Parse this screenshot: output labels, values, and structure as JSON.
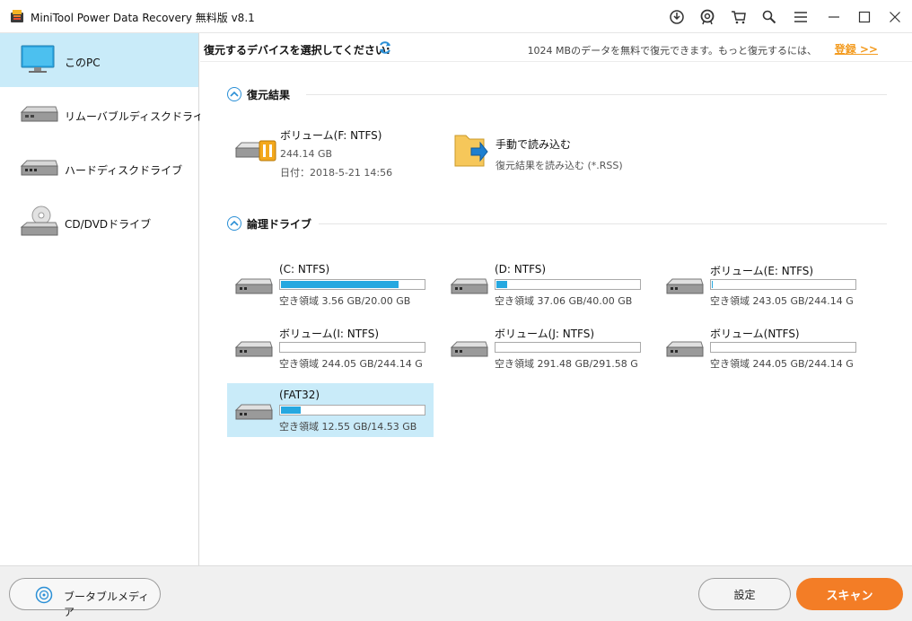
{
  "window": {
    "title": "MiniTool Power Data Recovery 無料版 v8.1",
    "controls": [
      "update-icon",
      "help-icon",
      "cart-icon",
      "search-icon",
      "menu-icon",
      "minimize-icon",
      "maximize-icon",
      "close-icon"
    ]
  },
  "sidebar": {
    "items": [
      {
        "label": "このPC",
        "icon": "pc-monitor-icon",
        "active": true
      },
      {
        "label": "リムーバブルディスクドライブ",
        "icon": "removable-drive-icon",
        "active": false
      },
      {
        "label": "ハードディスクドライブ",
        "icon": "hard-disk-icon",
        "active": false
      },
      {
        "label": "CD/DVDドライブ",
        "icon": "cd-dvd-drive-icon",
        "active": false
      }
    ]
  },
  "header": {
    "select_device_label": "復元するデバイスを選択してください:",
    "promo_text": "1024 MBのデータを無料で復元できます。もっと復元するには、",
    "register_link": "登録 >>"
  },
  "recovery_results": {
    "title": "復元結果",
    "items": [
      {
        "name": "ボリューム(F: NTFS)",
        "size": "244.14 GB",
        "date": "日付：2018-5-21 14:56"
      },
      {
        "name": "手動で読み込む",
        "desc": "復元結果を読み込む (*.RSS)"
      }
    ]
  },
  "logical_drives": {
    "title": "論理ドライブ",
    "drives": [
      {
        "name": "(C: NTFS)",
        "free": "空き領域 3.56 GB/20.00 GB",
        "used_fraction": 0.822
      },
      {
        "name": "(D: NTFS)",
        "free": "空き領域 37.06 GB/40.00 GB",
        "used_fraction": 0.074
      },
      {
        "name": "ボリューム(E: NTFS)",
        "free": "空き領域 243.05 GB/244.14 G",
        "used_fraction": 0.004
      },
      {
        "name": "ボリューム(I: NTFS)",
        "free": "空き領域 244.05 GB/244.14 G",
        "used_fraction": 0.0
      },
      {
        "name": "ボリューム(J: NTFS)",
        "free": "空き領域 291.48 GB/291.58 G",
        "used_fraction": 0.0
      },
      {
        "name": "ボリューム(NTFS)",
        "free": "空き領域 244.05 GB/244.14 G",
        "used_fraction": 0.0
      },
      {
        "name": "(FAT32)",
        "free": "空き領域 12.55 GB/14.53 GB",
        "used_fraction": 0.136,
        "selected": true
      }
    ]
  },
  "footer": {
    "portable_media": "ブータブルメディア",
    "settings": "設定",
    "scan": "スキャン"
  },
  "colors": {
    "accent_blue": "#26a8e0",
    "selection": "#c9ebf9",
    "scan_orange": "#f37d26",
    "link_orange": "#f39b1f"
  }
}
